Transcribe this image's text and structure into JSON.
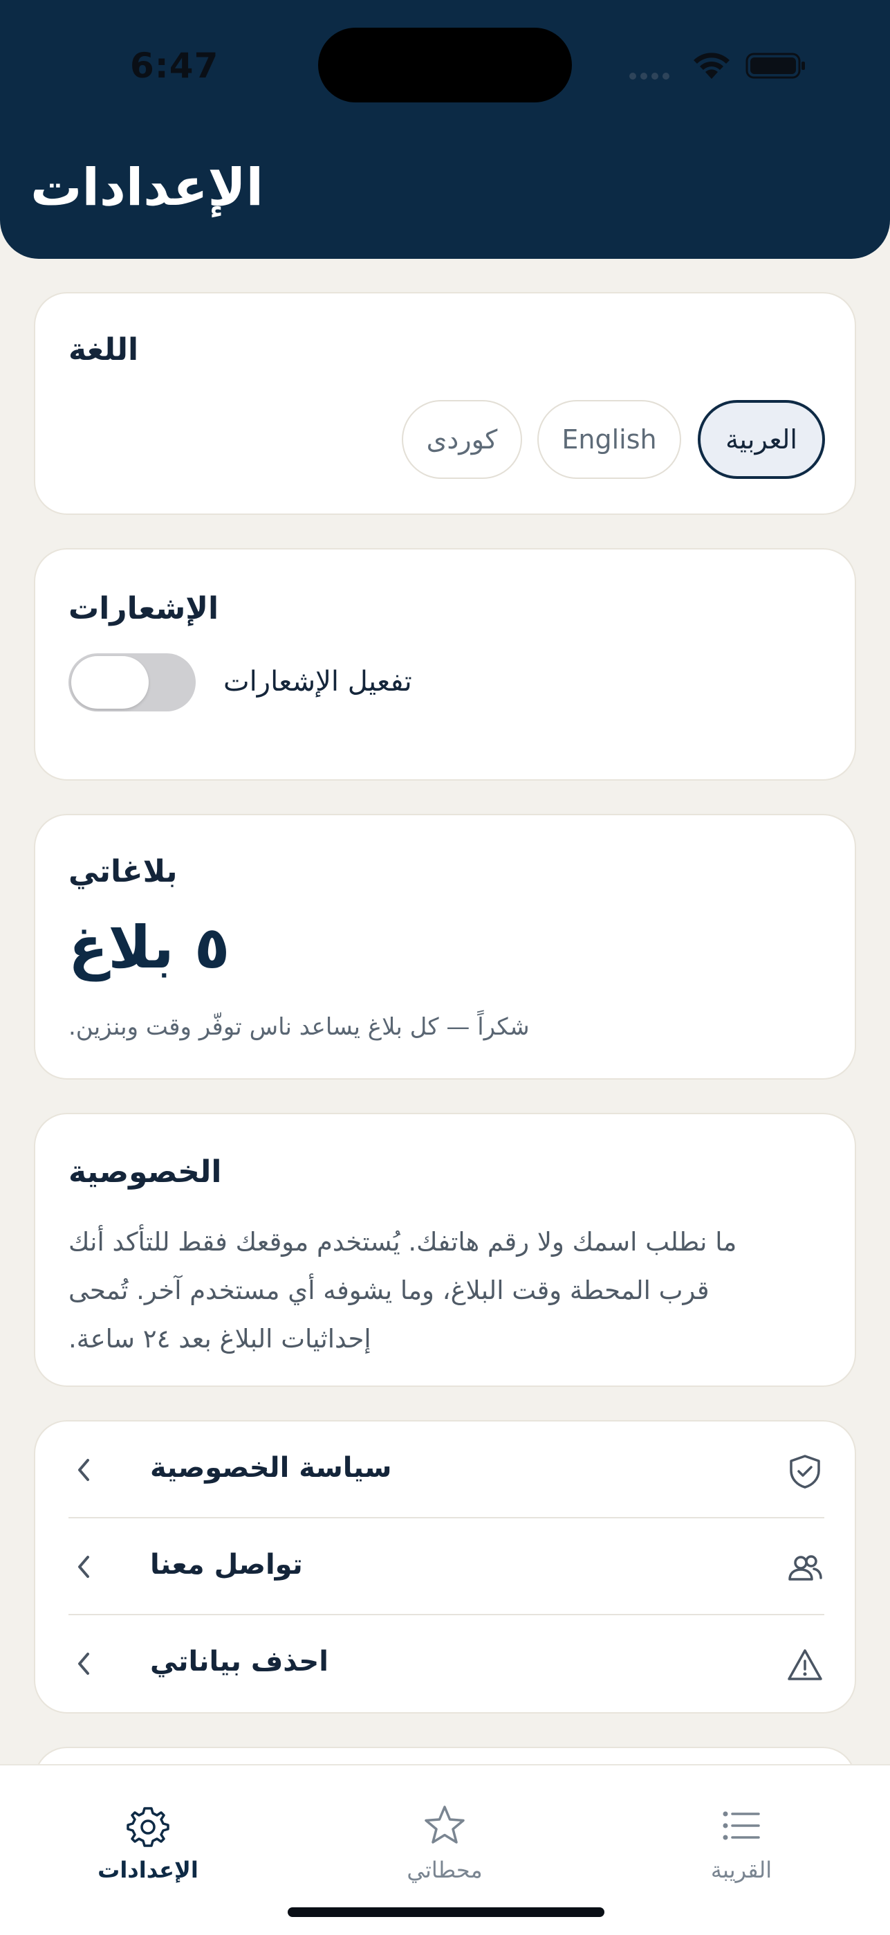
{
  "status_bar": {
    "time": "6:47"
  },
  "header": {
    "title": "الإعدادات"
  },
  "language": {
    "title": "اللغة",
    "options": [
      "العربية",
      "English",
      "كوردى"
    ],
    "selected": "العربية"
  },
  "notifications": {
    "title": "الإشعارات",
    "toggle_label": "تفعيل الإشعارات",
    "enabled": false
  },
  "reports": {
    "title": "بلاغاتي",
    "count_text": "٥ بلاغ",
    "note": "شكراً — كل بلاغ يساعد ناس توفّر وقت وبنزين."
  },
  "privacy": {
    "title": "الخصوصية",
    "lines": [
      "ما نطلب اسمك ولا رقم هاتفك. يُستخدم موقعك فقط للتأكد أنك",
      "قرب المحطة وقت البلاغ، وما يشوفه أي مستخدم آخر. تُمحى",
      "إحداثيات البلاغ بعد ٢٤ ساعة."
    ]
  },
  "links": [
    {
      "label": "سياسة الخصوصية",
      "icon": "shield-check-icon"
    },
    {
      "label": "تواصل معنا",
      "icon": "users-icon"
    },
    {
      "label": "احذف بياناتي",
      "icon": "warning-icon"
    }
  ],
  "tabbar": {
    "items": [
      {
        "label": "الإعدادات",
        "icon": "gear-icon",
        "active": true
      },
      {
        "label": "محطاتي",
        "icon": "star-icon",
        "active": false
      },
      {
        "label": "القريبة",
        "icon": "list-icon",
        "active": false
      }
    ]
  },
  "colors": {
    "header_bg": "#0C2A45",
    "page_bg": "#F3F1EC",
    "accent": "#0E2A45",
    "muted_text": "#5A6673"
  }
}
